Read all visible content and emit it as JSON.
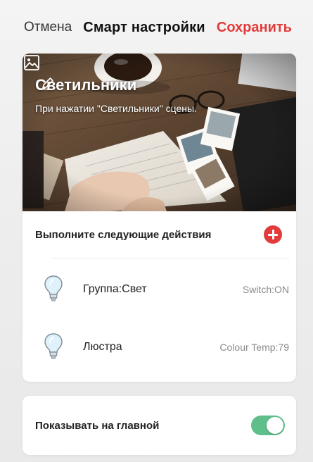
{
  "header": {
    "cancel_label": "Отмена",
    "title": "Смарт настройки",
    "save_label": "Сохранить"
  },
  "scene": {
    "name": "Светильники",
    "description": "При нажатии \"Светильники\" сцены.",
    "edit_icon": "pencil-icon",
    "cover_icon": "image-icon"
  },
  "actions": {
    "section_label": "Выполните следующие действия",
    "add_icon": "plus-circle-icon",
    "items": [
      {
        "name": "Группа:Свет",
        "value": "Switch:ON",
        "icon": "light-bulb-icon"
      },
      {
        "name": "Люстра",
        "value": "Colour Temp:79",
        "icon": "light-bulb-icon"
      }
    ]
  },
  "show_on_home": {
    "label": "Показывать на главной",
    "enabled": true
  },
  "colors": {
    "accent": "#e23b3b",
    "toggle_on": "#5fbf8a",
    "secondary_text": "#8a8a8a"
  }
}
